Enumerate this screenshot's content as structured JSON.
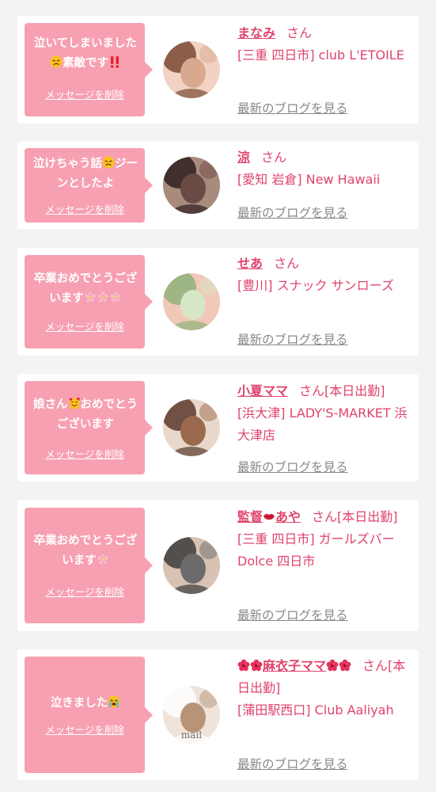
{
  "delete_label": "メッセージを削除",
  "blog_label": "最新のブログを見る",
  "honorific": "さん",
  "cards": [
    {
      "message": [
        {
          "t": "泣いてしまいました"
        },
        {
          "emoji": "sad-face-emoji"
        },
        {
          "t": "素敵です"
        },
        {
          "emoji": "double-exclamation-emoji"
        }
      ],
      "name": [
        {
          "t": "まなみ"
        }
      ],
      "suffix": "",
      "shop": "[三重 四日市] club L'ETOILE",
      "avatar": {
        "tones": [
          "#7a4a35",
          "#d8a98f",
          "#f2d2c3"
        ]
      }
    },
    {
      "message": [
        {
          "t": "泣けちゃう話"
        },
        {
          "emoji": "sad-face-emoji"
        },
        {
          "t": "ジーンとしたよ"
        }
      ],
      "name": [
        {
          "t": "涼"
        }
      ],
      "suffix": "",
      "shop": "[愛知 岩倉] New Hawaii",
      "avatar": {
        "tones": [
          "#2e1e1e",
          "#6b4a45",
          "#a88b7d"
        ]
      }
    },
    {
      "message": [
        {
          "t": "卒業おめでとうございます"
        },
        {
          "emoji": "cherry-blossom-emoji"
        },
        {
          "emoji": "cherry-blossom-emoji"
        },
        {
          "emoji": "cherry-blossom-emoji"
        }
      ],
      "name": [
        {
          "t": "せあ"
        }
      ],
      "suffix": "",
      "shop": "[豊川] スナック サンローズ",
      "avatar": {
        "tones": [
          "#8fb27a",
          "#d7e6c4",
          "#f0c8b8"
        ]
      }
    },
    {
      "message": [
        {
          "t": "娘さん"
        },
        {
          "emoji": "smiling-face-with-hearts-emoji"
        },
        {
          "t": "おめでとうございます"
        }
      ],
      "name": [
        {
          "t": "小夏ママ"
        }
      ],
      "suffix": "[本日出勤]",
      "shop": "[浜大津] LADY'S-MARKET 浜大津店",
      "avatar": {
        "tones": [
          "#5a3a2a",
          "#9b6a4e",
          "#e8d8cc"
        ]
      }
    },
    {
      "message": [
        {
          "t": "卒業おめでとうございます"
        },
        {
          "emoji": "cherry-blossom-emoji"
        }
      ],
      "name": [
        {
          "t": "監督"
        },
        {
          "emoji": "lips-emoji"
        },
        {
          "t": "あや"
        }
      ],
      "suffix": "[本日出勤]",
      "shop": "[三重 四日市] ガールズバー Dolce 四日市",
      "avatar": {
        "tones": [
          "#3b3b3b",
          "#6b6b6b",
          "#d8c2b4"
        ]
      }
    },
    {
      "message": [
        {
          "t": "泣きました"
        },
        {
          "emoji": "crying-face-emoji"
        }
      ],
      "name": [
        {
          "emoji": "hibiscus-emoji"
        },
        {
          "emoji": "hibiscus-emoji"
        },
        {
          "t": "麻衣子ママ"
        },
        {
          "emoji": "hibiscus-emoji"
        },
        {
          "emoji": "hibiscus-emoji"
        }
      ],
      "suffix": "[本日出勤]",
      "shop": "[蒲田駅西口] Club Aaliyah",
      "avatar": {
        "tones": [
          "#ffffff",
          "#b79378",
          "#efe3da"
        ],
        "caption": "mail"
      }
    }
  ]
}
